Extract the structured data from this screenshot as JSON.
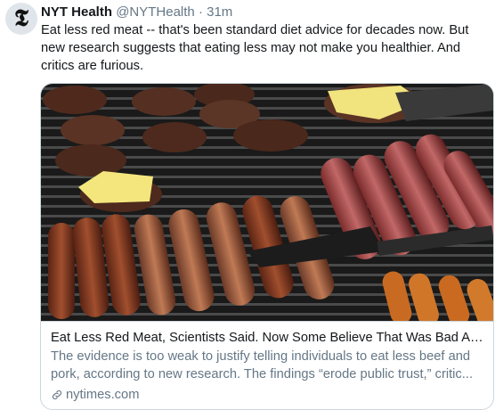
{
  "tweet": {
    "author_name": "NYT Health",
    "author_handle": "@NYTHealth",
    "separator": "·",
    "time": "31m",
    "avatar_letter": "𝕿",
    "text": "Eat less red meat -- that's been standard diet advice for decades now. But new research suggests that eating less may not make you healthier. And critics are furious."
  },
  "card": {
    "title": "Eat Less Red Meat, Scientists Said. Now Some Believe That Was Bad Adv...",
    "description": "The evidence is too weak to justify telling individuals to eat less beef and pork, according to new research. The findings “erode public trust,” critic...",
    "domain": "nytimes.com",
    "domain_icon": "link-icon",
    "image_icon": "grill-photo"
  }
}
